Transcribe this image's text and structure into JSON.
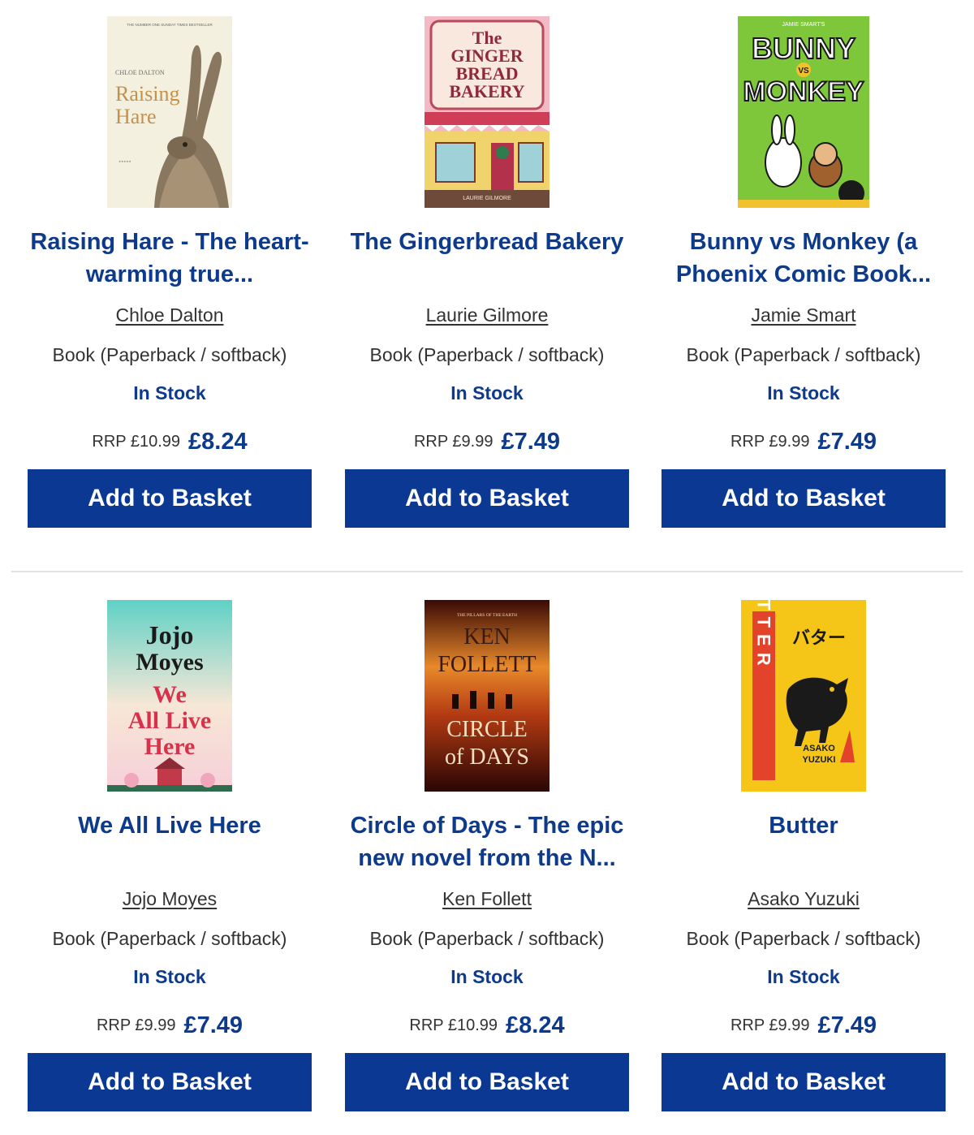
{
  "colors": {
    "brand_blue": "#0a3893",
    "title_blue": "#0e3a8c",
    "divider": "#e1e1e1"
  },
  "products": [
    {
      "cover_icon": "raising-hare-cover",
      "cover_text": [
        "THE NUMBER ONE SUNDAY TIMES BESTSELLER",
        "CHLOE DALTON",
        "Raising",
        "Hare"
      ],
      "title": "Raising Hare - The heart-warming true...",
      "author": "Chloe Dalton",
      "format": "Book (Paperback / softback)",
      "stock": "In Stock",
      "rrp": "RRP £10.99",
      "price": "£8.24",
      "button": "Add to Basket"
    },
    {
      "cover_icon": "gingerbread-bakery-cover",
      "cover_text": [
        "The",
        "GINGER",
        "BREAD",
        "BAKERY",
        "LAURIE GILMORE"
      ],
      "title": "The Gingerbread Bakery",
      "author": "Laurie Gilmore",
      "format": "Book (Paperback / softback)",
      "stock": "In Stock",
      "rrp": "RRP £9.99",
      "price": "£7.49",
      "button": "Add to Basket"
    },
    {
      "cover_icon": "bunny-vs-monkey-cover",
      "cover_text": [
        "JAMIE SMART'S",
        "BUNNY",
        "VS",
        "MONKEY"
      ],
      "title": "Bunny vs Monkey (a Phoenix Comic Book...",
      "author": "Jamie Smart",
      "format": "Book (Paperback / softback)",
      "stock": "In Stock",
      "rrp": "RRP £9.99",
      "price": "£7.49",
      "button": "Add to Basket"
    },
    {
      "cover_icon": "we-all-live-here-cover",
      "cover_text": [
        "Jojo",
        "Moyes",
        "We",
        "All Live",
        "Here"
      ],
      "title": "We All Live Here",
      "author": "Jojo Moyes",
      "format": "Book (Paperback / softback)",
      "stock": "In Stock",
      "rrp": "RRP £9.99",
      "price": "£7.49",
      "button": "Add to Basket"
    },
    {
      "cover_icon": "circle-of-days-cover",
      "cover_text": [
        "THE PILLARS OF THE EARTH",
        "KEN",
        "FOLLETT",
        "CIRCLE",
        "of DAYS"
      ],
      "title": "Circle of Days - The epic new novel from the N...",
      "author": "Ken Follett",
      "format": "Book (Paperback / softback)",
      "stock": "In Stock",
      "rrp": "RRP £10.99",
      "price": "£8.24",
      "button": "Add to Basket"
    },
    {
      "cover_icon": "butter-cover",
      "cover_text": [
        "BUTTER",
        "バター",
        "ASAKO",
        "YUZUKI"
      ],
      "title": "Butter",
      "author": "Asako Yuzuki",
      "format": "Book (Paperback / softback)",
      "stock": "In Stock",
      "rrp": "RRP £9.99",
      "price": "£7.49",
      "button": "Add to Basket"
    }
  ]
}
